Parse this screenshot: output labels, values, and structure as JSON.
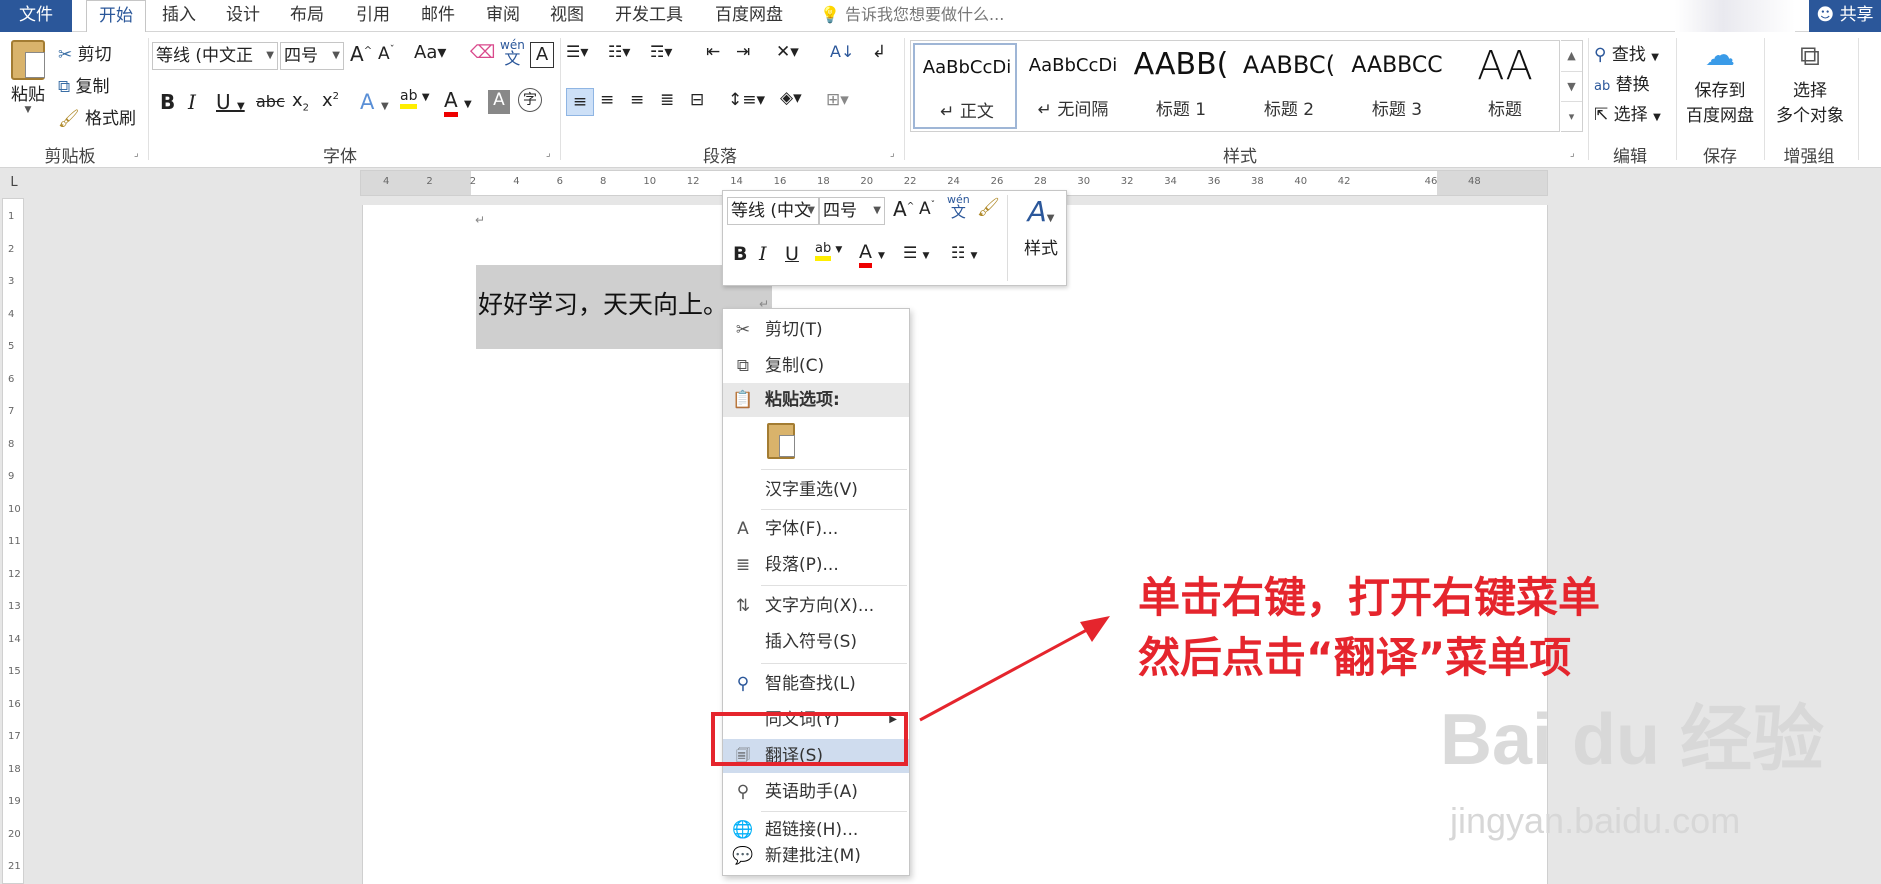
{
  "tabs": [
    "文件",
    "开始",
    "插入",
    "设计",
    "布局",
    "引用",
    "邮件",
    "审阅",
    "视图",
    "开发工具",
    "百度网盘"
  ],
  "tell_me": "告诉我您想要做什么...",
  "share": "共享",
  "clipboard": {
    "paste": "粘贴",
    "cut": "剪切",
    "copy": "复制",
    "painter": "格式刷",
    "label": "剪贴板"
  },
  "font": {
    "name": "等线 (中文正",
    "size": "四号",
    "label": "字体"
  },
  "paragraph": {
    "label": "段落"
  },
  "styles": {
    "label": "样式",
    "items": [
      {
        "sample": "AaBbCcDi",
        "name": "↵ 正文"
      },
      {
        "sample": "AaBbCcDi",
        "name": "↵ 无间隔"
      },
      {
        "sample": "AABB(",
        "name": "标题 1"
      },
      {
        "sample": "AABBC(",
        "name": "标题 2"
      },
      {
        "sample": "AABBCC",
        "name": "标题 3"
      },
      {
        "sample": "AA",
        "name": "标题"
      }
    ]
  },
  "editing": {
    "find": "查找",
    "replace": "替换",
    "select": "选择",
    "label": "编辑"
  },
  "save": {
    "line1": "保存到",
    "line2": "百度网盘",
    "label": "保存"
  },
  "enhance": {
    "line1": "选择",
    "line2": "多个对象",
    "label": "增强组"
  },
  "ruler_corner": "L",
  "ruler_marks": [
    "4",
    "2",
    "2",
    "4",
    "6",
    "8",
    "10",
    "12",
    "14",
    "16",
    "18",
    "20",
    "22",
    "24",
    "26",
    "28",
    "30",
    "32",
    "34",
    "36",
    "38",
    "40",
    "42",
    "46",
    "48"
  ],
  "vruler_marks": [
    "1",
    "2",
    "3",
    "4",
    "5",
    "6",
    "7",
    "8",
    "9",
    "10",
    "11",
    "12",
    "13",
    "14",
    "15",
    "16",
    "17",
    "18",
    "19",
    "20",
    "21"
  ],
  "document_text": "好好学习，天天向上。",
  "mini_toolbar": {
    "font": "等线 (中文",
    "size": "四号",
    "styles": "样式"
  },
  "context_menu": {
    "cut": "剪切(T)",
    "copy": "复制(C)",
    "paste_options": "粘贴选项:",
    "reconvert": "汉字重选(V)",
    "font": "字体(F)...",
    "paragraph": "段落(P)...",
    "text_direction": "文字方向(X)...",
    "insert_symbol": "插入符号(S)",
    "smart_lookup": "智能查找(L)",
    "synonyms": "同义词(Y)",
    "translate": "翻译(S)",
    "english_assistant": "英语助手(A)",
    "hyperlink": "超链接(H)...",
    "new_comment": "新建批注(M)"
  },
  "annotation": {
    "line1": "单击右键，打开右键菜单",
    "line2": "然后点击“翻译”菜单项"
  },
  "watermark": {
    "logo": "Bai du 经验",
    "url": "jingyan.baidu.com"
  },
  "colors": {
    "accent": "#2b579a",
    "annotation": "#e5252d",
    "highlight": "#cfdcee"
  }
}
